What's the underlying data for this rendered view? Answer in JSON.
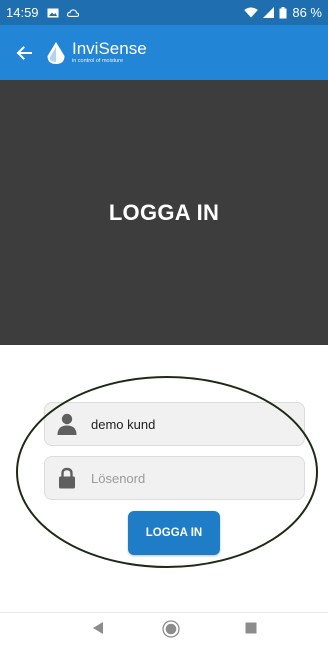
{
  "status_bar": {
    "time": "14:59",
    "battery": "86 %"
  },
  "app_bar": {
    "brand_name": "InviSense",
    "brand_tagline": "in control of moisture"
  },
  "hero": {
    "title": "LOGGA IN"
  },
  "form": {
    "username_value": "demo kund",
    "password_placeholder": "Lösenord",
    "submit_label": "LOGGA IN"
  },
  "colors": {
    "status_bar": "#1f6fb0",
    "app_bar": "#2385d6",
    "hero": "#3d3d3d",
    "button": "#1e7dc6"
  }
}
